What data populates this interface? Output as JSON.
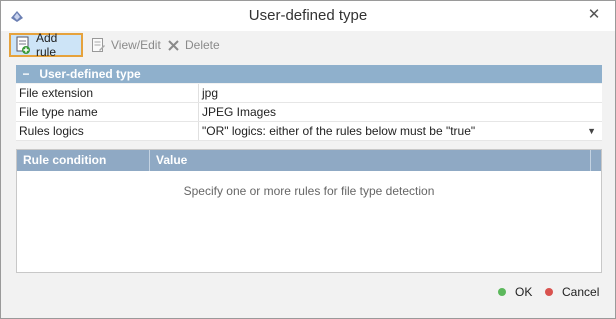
{
  "window": {
    "title": "User-defined type",
    "close_glyph": "✕",
    "app_icon": "ufs-app-icon"
  },
  "toolbar": {
    "add_rule_label": "Add rule",
    "view_edit_label": "View/Edit",
    "delete_label": "Delete"
  },
  "group": {
    "title": "User-defined type",
    "collapse_glyph": "−"
  },
  "properties": [
    {
      "label": "File extension",
      "value": "jpg"
    },
    {
      "label": "File type name",
      "value": "JPEG Images"
    },
    {
      "label": "Rules logics",
      "value": "\"OR\" logics: either of the rules below must be \"true\""
    }
  ],
  "rules_table": {
    "columns": [
      "Rule condition",
      "Value"
    ],
    "empty_message": "Specify one or more rules for file type detection"
  },
  "footer": {
    "ok_label": "OK",
    "cancel_label": "Cancel"
  },
  "colors": {
    "ok_dot": "#5cb85c",
    "cancel_dot": "#d9534f",
    "header_blue": "#8fb0cc",
    "selected_border": "#e6a23c"
  }
}
